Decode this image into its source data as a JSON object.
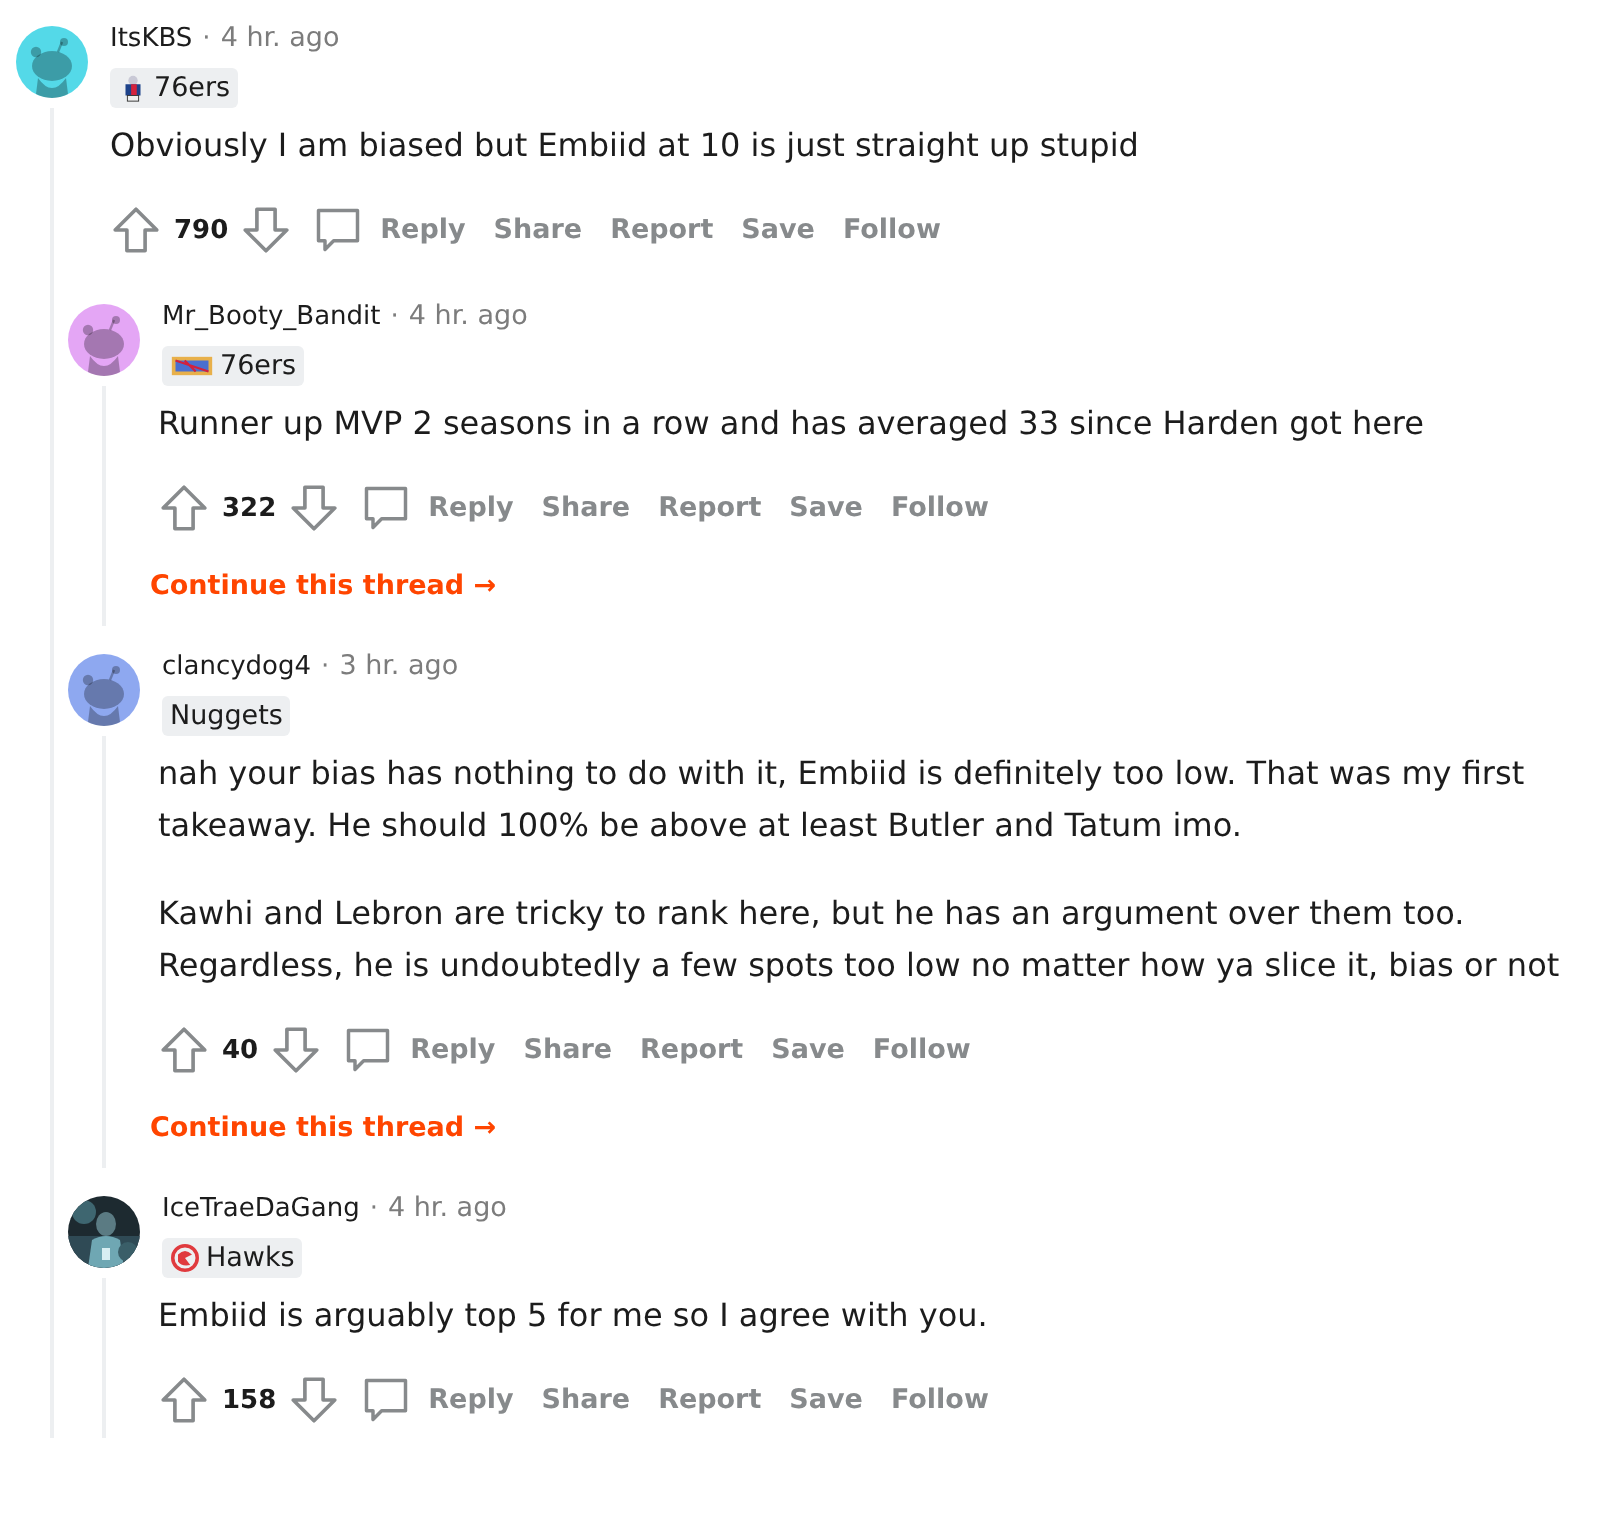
{
  "comment": {
    "author": "ItsKBS",
    "time": "4 hr. ago",
    "avatar": {
      "kind": "snoo",
      "color": "#54d9e8"
    },
    "separator": "·",
    "flair": {
      "text": "76ers",
      "kind": "mascot"
    },
    "paragraphs": [
      "Obviously I am biased but Embiid at 10 is just straight up stupid"
    ],
    "votes": "790",
    "actions": [
      "Reply",
      "Share",
      "Report",
      "Save",
      "Follow"
    ],
    "replies": [
      {
        "author": "Mr_Booty_Bandit",
        "time": "4 hr. ago",
        "avatar": {
          "kind": "snoo",
          "color": "#e4a6f5"
        },
        "separator": "·",
        "flair": {
          "text": "76ers",
          "kind": "banner"
        },
        "paragraphs": [
          "Runner up MVP 2 seasons in a row and has averaged 33 since Harden got here"
        ],
        "votes": "322",
        "actions": [
          "Reply",
          "Share",
          "Report",
          "Save",
          "Follow"
        ],
        "continue": "Continue this thread →"
      },
      {
        "author": "clancydog4",
        "time": "3 hr. ago",
        "avatar": {
          "kind": "snoo",
          "color": "#8ea8f0"
        },
        "separator": "·",
        "flair": {
          "text": "Nuggets",
          "kind": "text"
        },
        "paragraphs": [
          "nah your bias has nothing to do with it, Embiid is definitely too low. That was my first takeaway. He should 100% be above at least Butler and Tatum imo.",
          "Kawhi and Lebron are tricky to rank here, but he has an argument over them too. Regardless, he is undoubtedly a few spots too low no matter how ya slice it, bias or not"
        ],
        "votes": "40",
        "actions": [
          "Reply",
          "Share",
          "Report",
          "Save",
          "Follow"
        ],
        "continue": "Continue this thread →"
      },
      {
        "author": "IceTraeDaGang",
        "time": "4 hr. ago",
        "avatar": {
          "kind": "picture"
        },
        "separator": "·",
        "flair": {
          "text": "Hawks",
          "kind": "hawk"
        },
        "paragraphs": [
          "Embiid is arguably top 5 for me so I agree with you."
        ],
        "votes": "158",
        "actions": [
          "Reply",
          "Share",
          "Report",
          "Save",
          "Follow"
        ]
      }
    ]
  }
}
